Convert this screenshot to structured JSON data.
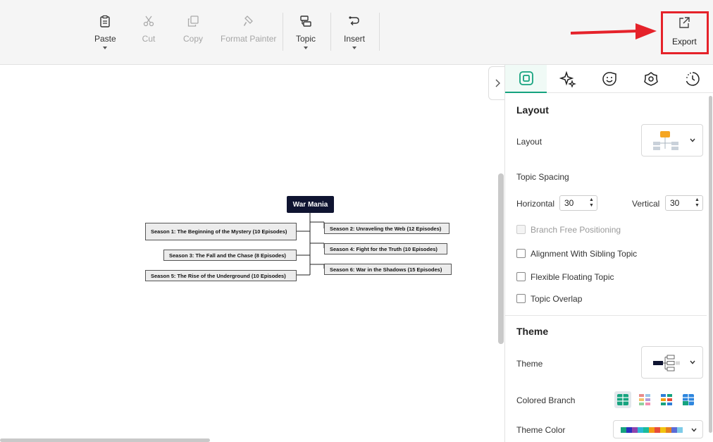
{
  "toolbar": {
    "paste": "Paste",
    "cut": "Cut",
    "copy": "Copy",
    "format_painter": "Format Painter",
    "topic": "Topic",
    "insert": "Insert",
    "export": "Export"
  },
  "mindmap": {
    "root": "War Mania",
    "left_topics": [
      "Season 1: The Beginning of the Mystery (10 Episodes)",
      "Season 3: The Fall and the Chase (8 Episodes)",
      "Season 5: The Rise of the Underground (10 Episodes)"
    ],
    "right_topics": [
      "Season 2: Unraveling the Web (12 Episodes)",
      "Season 4: Fight for the Truth (10 Episodes)",
      "Season 6: War in the Shadows (15 Episodes)"
    ],
    "root_color": "#0f1431"
  },
  "panel": {
    "layout_section": {
      "title": "Layout",
      "layout_label": "Layout",
      "topic_spacing_label": "Topic Spacing",
      "horizontal_label": "Horizontal",
      "horizontal_value": "30",
      "vertical_label": "Vertical",
      "vertical_value": "30",
      "checkboxes": [
        {
          "label": "Branch Free Positioning",
          "checked": false,
          "disabled": true
        },
        {
          "label": "Alignment With Sibling Topic",
          "checked": false,
          "disabled": false
        },
        {
          "label": "Flexible Floating Topic",
          "checked": false,
          "disabled": false
        },
        {
          "label": "Topic Overlap",
          "checked": false,
          "disabled": false
        }
      ]
    },
    "theme_section": {
      "title": "Theme",
      "theme_label": "Theme",
      "colored_branch_label": "Colored Branch",
      "theme_color_label": "Theme Color"
    },
    "accent_color": "#16a37f",
    "highlight_color": "#e5222a"
  }
}
